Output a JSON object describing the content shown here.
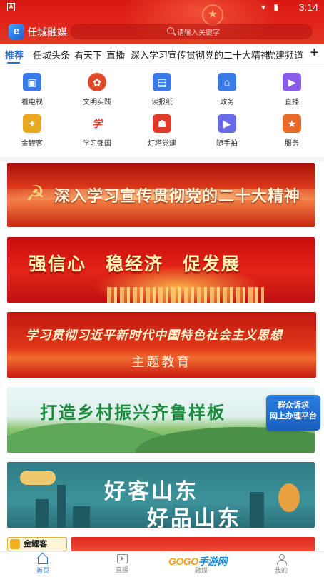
{
  "status_bar": {
    "notification_glyph": "A",
    "icons": [
      "wifi-icon",
      "signal-icon",
      "battery-icon"
    ],
    "time": "3:14"
  },
  "header": {
    "app_name": "任城融媒",
    "app_logo_glyph": "e",
    "search_placeholder": "请输入关键字"
  },
  "tabs": [
    {
      "label": "推荐",
      "active": true
    },
    {
      "label": "任城头条"
    },
    {
      "label": "看天下"
    },
    {
      "label": "直播"
    },
    {
      "label": "深入学习宣传贯彻党的二十大精神"
    },
    {
      "label": "党建频道"
    }
  ],
  "tabs_add": "+",
  "quick_grid": [
    {
      "label": "看电视",
      "icon": "tv-icon",
      "color": "#3b7be8",
      "glyph": "▣"
    },
    {
      "label": "文明实践",
      "icon": "flower-icon",
      "color": "#e04a2a",
      "glyph": "✿"
    },
    {
      "label": "读报纸",
      "icon": "newspaper-icon",
      "color": "#3b7be8",
      "glyph": "▤"
    },
    {
      "label": "政务",
      "icon": "government-building-icon",
      "color": "#3b7be8",
      "glyph": "⌂"
    },
    {
      "label": "直播",
      "icon": "video-icon",
      "color": "#8a5ae8",
      "glyph": "▶"
    },
    {
      "label": "金鲤客",
      "icon": "carp-icon",
      "color": "#e8a820",
      "glyph": "✦"
    },
    {
      "label": "学习强国",
      "icon": "xuexi-icon",
      "color": "#e03a2a",
      "glyph": "学"
    },
    {
      "label": "灯塔党建",
      "icon": "lighthouse-icon",
      "color": "#e03a2a",
      "glyph": "☗"
    },
    {
      "label": "随手拍",
      "icon": "camera-icon",
      "color": "#6a6ae8",
      "glyph": "▶"
    },
    {
      "label": "服务",
      "icon": "service-icon",
      "color": "#e86a2a",
      "glyph": "★"
    }
  ],
  "banners": {
    "b1": "深入学习宣传贯彻党的二十大精神",
    "b2": "强信心 稳经济 促发展",
    "b3_line1": "学习贯彻习近平新时代中国特色社会主义思想",
    "b3_line2": "主题教育",
    "b4": "打造乡村振兴齐鲁样板",
    "b5_line1": "好客山东",
    "b5_line2": "好品山东",
    "b6_logo": "金鲤客"
  },
  "float_service": {
    "line1": "群众诉求",
    "line2": "网上办理平台"
  },
  "bottom_nav": [
    {
      "label": "首页",
      "icon": "home-icon",
      "active": true
    },
    {
      "label": "直播",
      "icon": "live-icon"
    },
    {
      "label": "融媒",
      "icon": "media-icon"
    },
    {
      "label": "我的",
      "icon": "user-icon"
    }
  ],
  "watermark": {
    "text_a": "GOGO",
    "text_b": "手游网"
  },
  "colors": {
    "accent": "#2b6fd6",
    "header_red": "#e2241a"
  }
}
